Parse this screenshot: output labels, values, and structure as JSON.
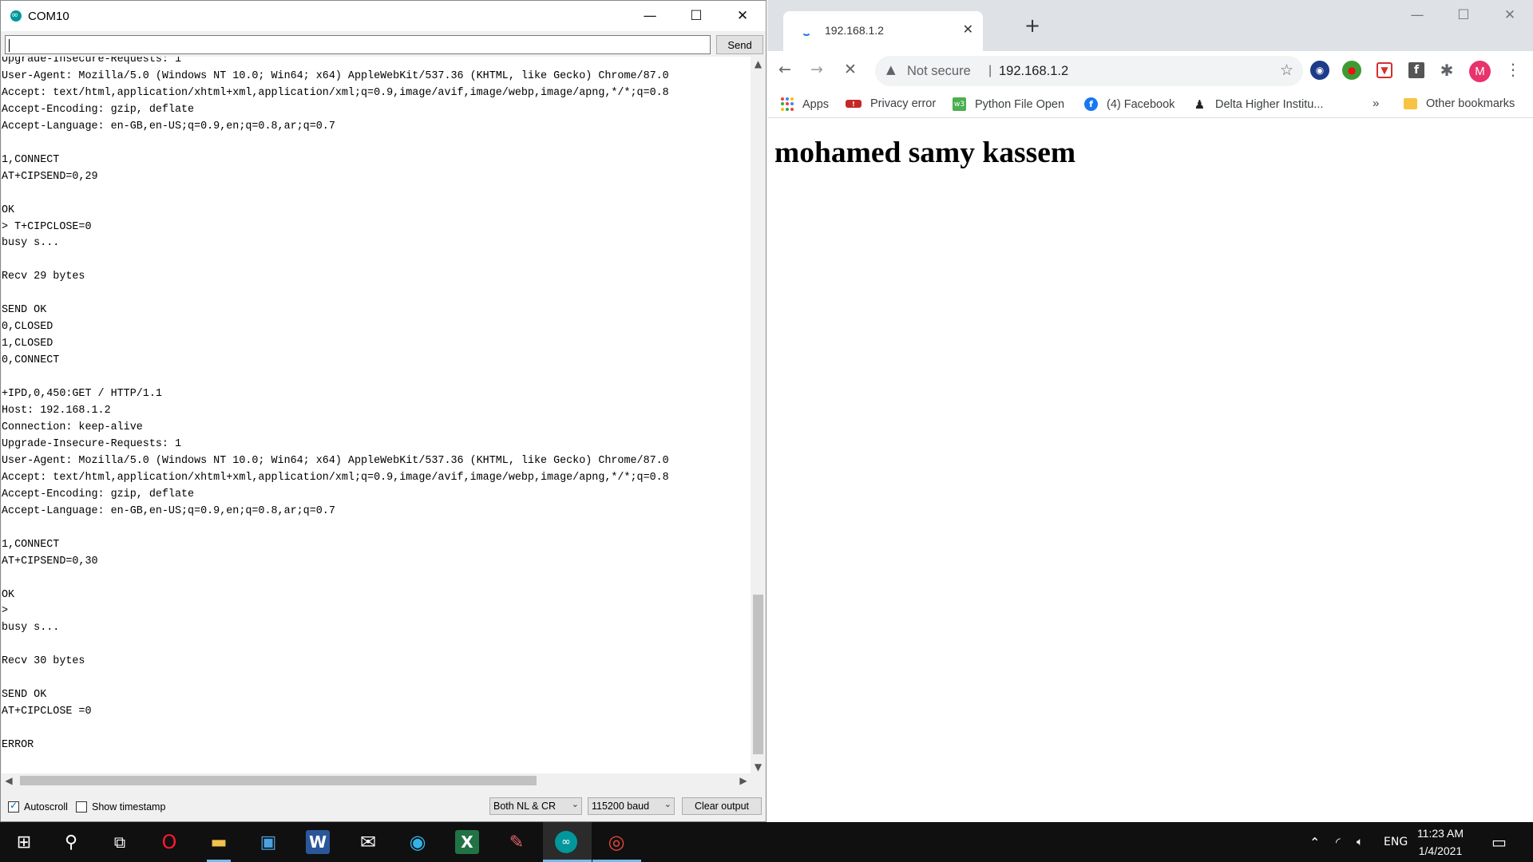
{
  "serial": {
    "title": "COM10",
    "send_value": "",
    "send_label": "Send",
    "output_lines": [
      "Upgrade-Insecure-Requests: 1",
      "User-Agent: Mozilla/5.0 (Windows NT 10.0; Win64; x64) AppleWebKit/537.36 (KHTML, like Gecko) Chrome/87.0",
      "Accept: text/html,application/xhtml+xml,application/xml;q=0.9,image/avif,image/webp,image/apng,*/*;q=0.8",
      "Accept-Encoding: gzip, deflate",
      "Accept-Language: en-GB,en-US;q=0.9,en;q=0.8,ar;q=0.7",
      "",
      "1,CONNECT",
      "AT+CIPSEND=0,29",
      "",
      "OK",
      "> T+CIPCLOSE=0",
      "busy s...",
      "",
      "Recv 29 bytes",
      "",
      "SEND OK",
      "0,CLOSED",
      "1,CLOSED",
      "0,CONNECT",
      "",
      "+IPD,0,450:GET / HTTP/1.1",
      "Host: 192.168.1.2",
      "Connection: keep-alive",
      "Upgrade-Insecure-Requests: 1",
      "User-Agent: Mozilla/5.0 (Windows NT 10.0; Win64; x64) AppleWebKit/537.36 (KHTML, like Gecko) Chrome/87.0",
      "Accept: text/html,application/xhtml+xml,application/xml;q=0.9,image/avif,image/webp,image/apng,*/*;q=0.8",
      "Accept-Encoding: gzip, deflate",
      "Accept-Language: en-GB,en-US;q=0.9,en;q=0.8,ar;q=0.7",
      "",
      "1,CONNECT",
      "AT+CIPSEND=0,30",
      "",
      "OK",
      ">",
      "busy s...",
      "",
      "Recv 30 bytes",
      "",
      "SEND OK",
      "AT+CIPCLOSE =0",
      "",
      "ERROR"
    ],
    "autoscroll_label": "Autoscroll",
    "autoscroll_checked": true,
    "timestamp_label": "Show timestamp",
    "timestamp_checked": false,
    "line_ending": "Both NL & CR",
    "baud": "115200 baud",
    "clear_label": "Clear output"
  },
  "chrome": {
    "tab_title": "192.168.1.2",
    "omnibox": {
      "security": "Not secure",
      "separator": "|",
      "url": "192.168.1.2"
    },
    "avatar_letter": "M",
    "bookmarks": [
      {
        "label": "Apps",
        "icon": "apps-grid-icon"
      },
      {
        "label": "Privacy error",
        "icon": "error-page-icon"
      },
      {
        "label": "Python File Open",
        "icon": "w3schools-icon"
      },
      {
        "label": "(4) Facebook",
        "icon": "facebook-icon"
      },
      {
        "label": "Delta Higher Institu...",
        "icon": "graduate-icon"
      }
    ],
    "bookmarks_more": "»",
    "other_bookmarks": "Other bookmarks",
    "page_heading": "mohamed samy kassem"
  },
  "taskbar": {
    "tray_language": "ENG",
    "time": "11:23 AM",
    "date": "1/4/2021"
  }
}
